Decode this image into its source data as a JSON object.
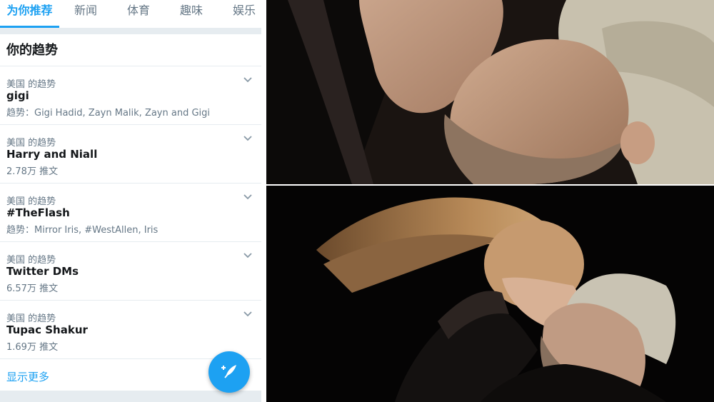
{
  "tabs": [
    {
      "label": "为你推荐",
      "active": true
    },
    {
      "label": "新闻",
      "active": false
    },
    {
      "label": "体育",
      "active": false
    },
    {
      "label": "趣味",
      "active": false
    },
    {
      "label": "娱乐",
      "active": false
    }
  ],
  "section_title": "你的趋势",
  "trends": [
    {
      "context": "美国 的趋势",
      "name": "gigi",
      "meta": "趋势：Gigi Hadid, Zayn Malik, Zayn and Gigi"
    },
    {
      "context": "美国 的趋势",
      "name": "Harry and Niall",
      "meta": "2.78万 推文"
    },
    {
      "context": "美国 的趋势",
      "name": "#TheFlash",
      "meta": "趋势：Mirror Iris, #WestAllen, Iris"
    },
    {
      "context": "美国 的趋势",
      "name": "Twitter DMs",
      "meta": "6.57万 推文"
    },
    {
      "context": "美国 的趋势",
      "name": "Tupac Shakur",
      "meta": "1.69万 推文"
    }
  ],
  "show_more": "显示更多",
  "icons": {
    "chevron": "chevron-down-icon",
    "compose": "compose-tweet-icon"
  },
  "colors": {
    "accent": "#1da1f2",
    "text_primary": "#14171a",
    "text_secondary": "#657786",
    "separator": "#e6ecf0"
  }
}
